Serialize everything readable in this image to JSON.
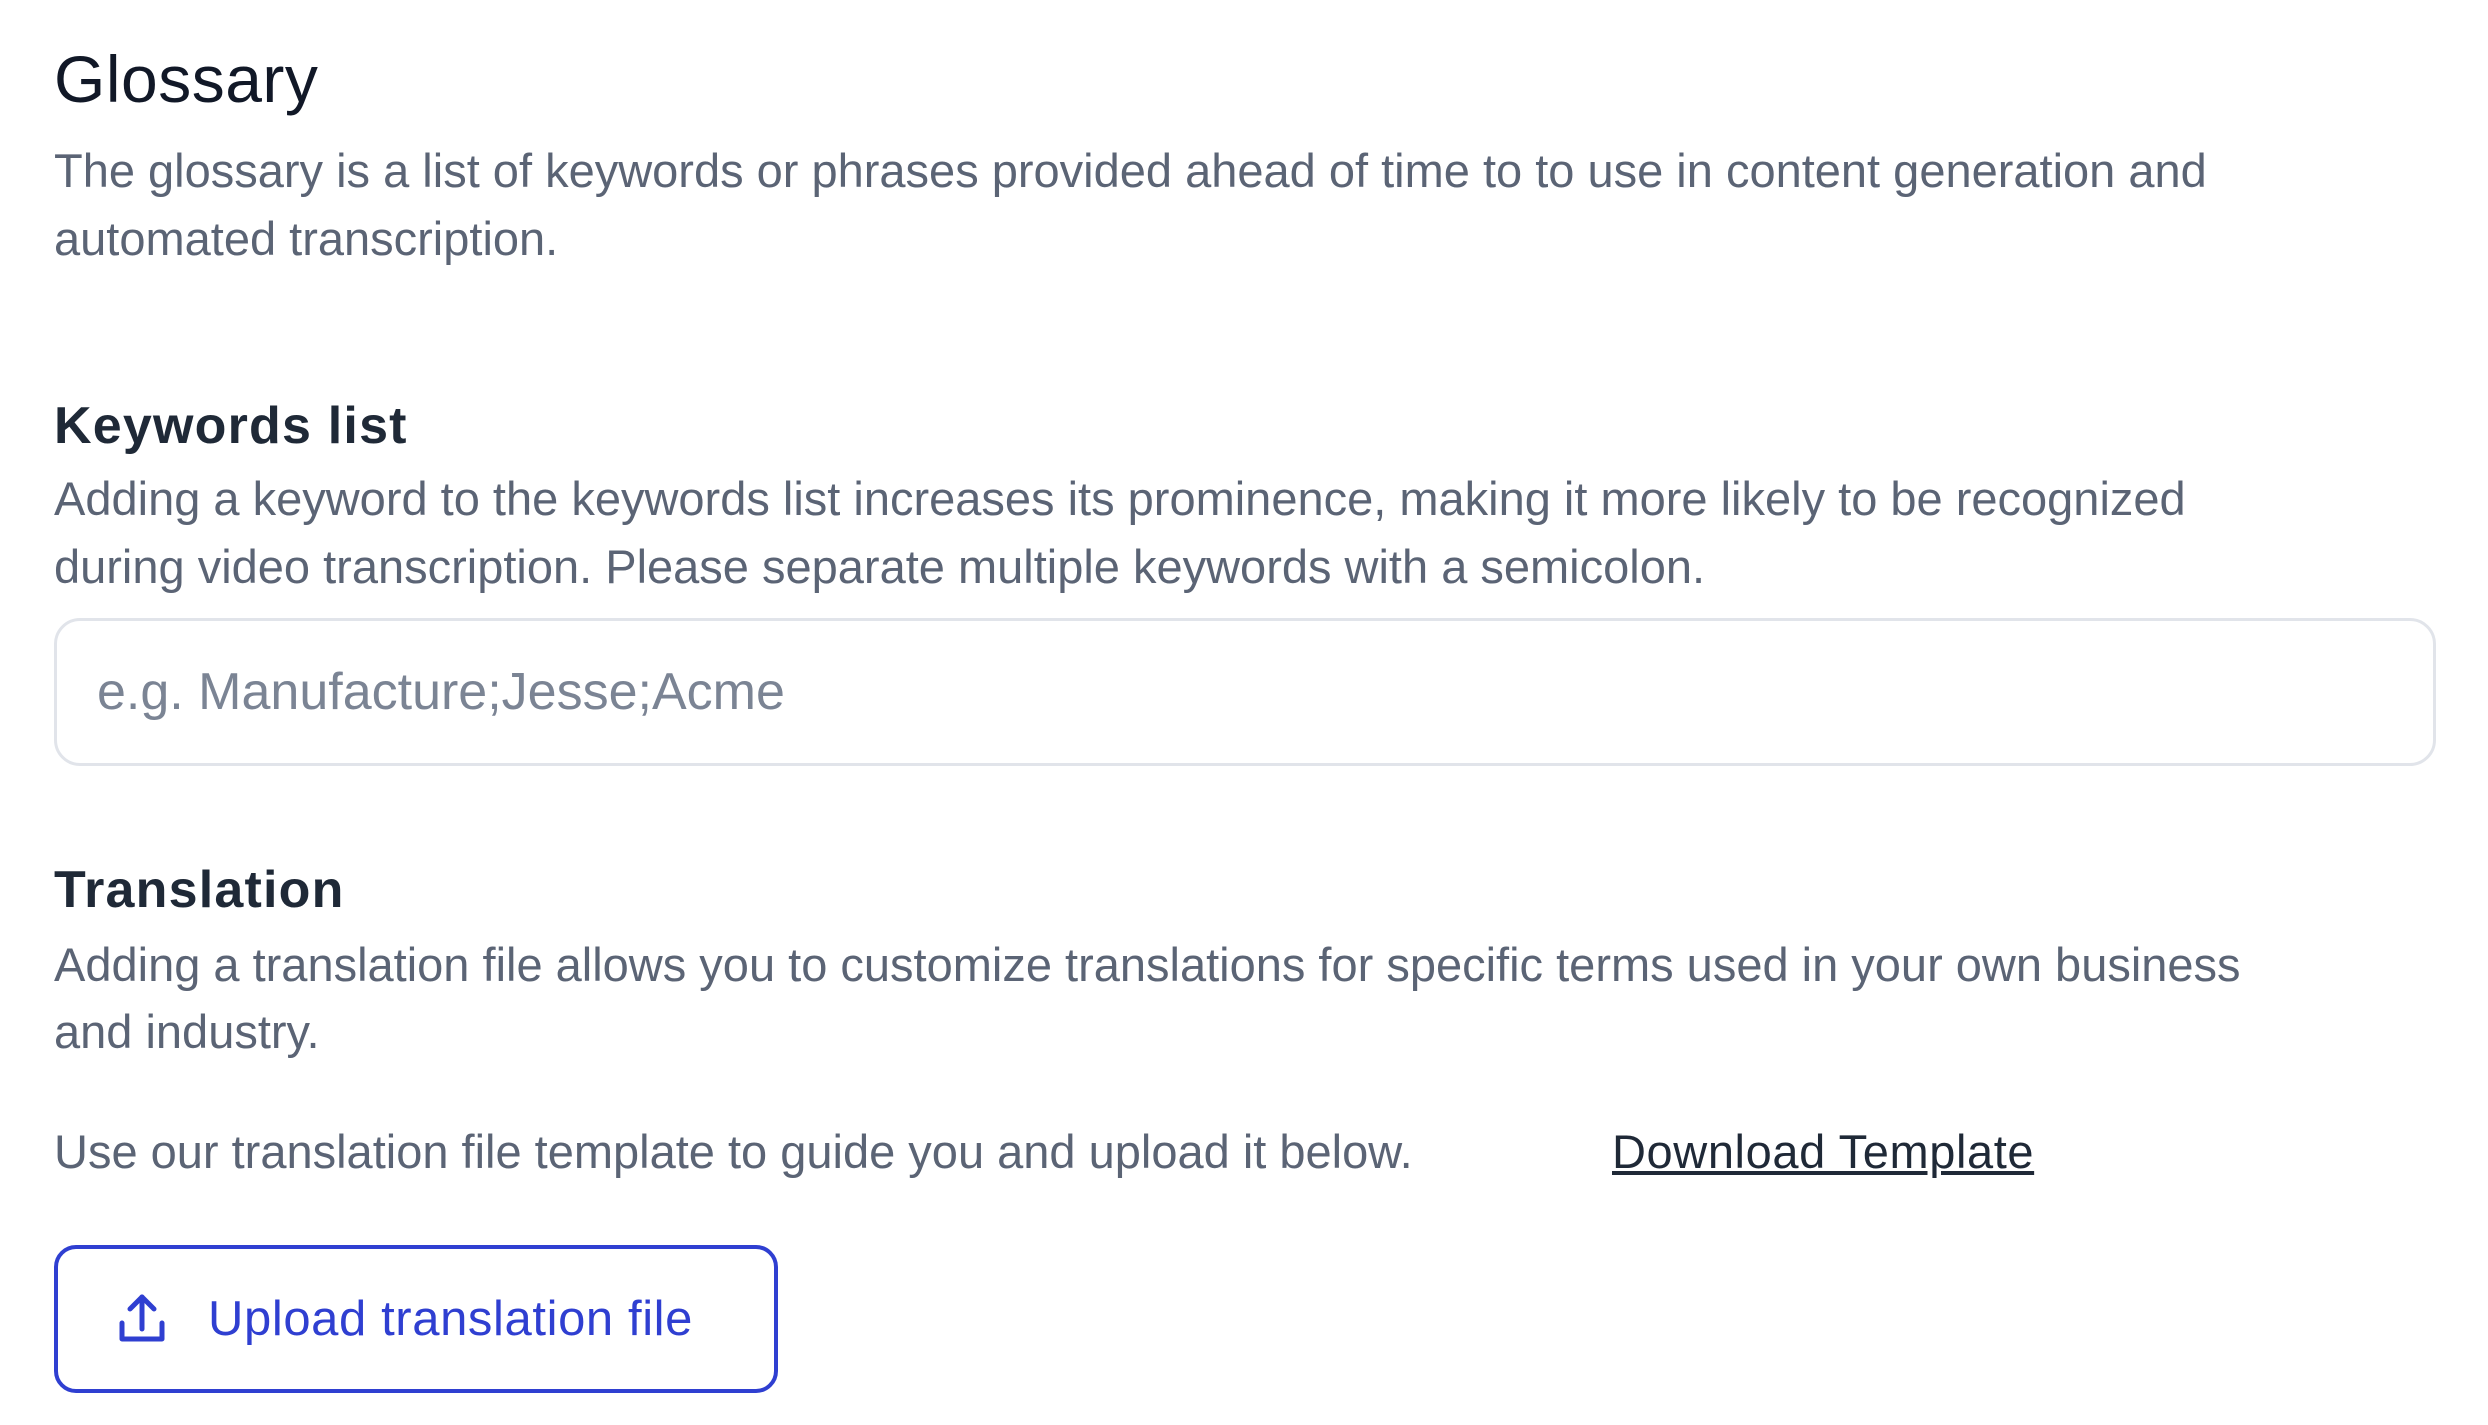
{
  "glossary": {
    "title": "Glossary",
    "description_line1": "The glossary is a list of keywords or phrases provided ahead of time to to use in content generation and",
    "description_line2": "automated transcription."
  },
  "keywords": {
    "heading": "Keywords list",
    "description_line1": "Adding a keyword to the keywords list increases its prominence, making it more likely to be recognized",
    "description_line2": "during video transcription. Please separate multiple keywords with a semicolon.",
    "input_value": "",
    "input_placeholder": "e.g. Manufacture;Jesse;Acme"
  },
  "translation": {
    "heading": "Translation",
    "description_line1": "Adding a translation file allows you to customize translations for specific terms used in your own business",
    "description_line2": "and industry.",
    "template_text": "Use our translation file template to guide you and upload it below.",
    "download_label": "Download Template",
    "upload_label": "Upload translation file",
    "upload_icon": "upload-icon"
  },
  "colors": {
    "accent": "#2f3fd1",
    "heading": "#1f2937",
    "muted_text": "#5b6475",
    "input_border": "#e1e4ea"
  }
}
